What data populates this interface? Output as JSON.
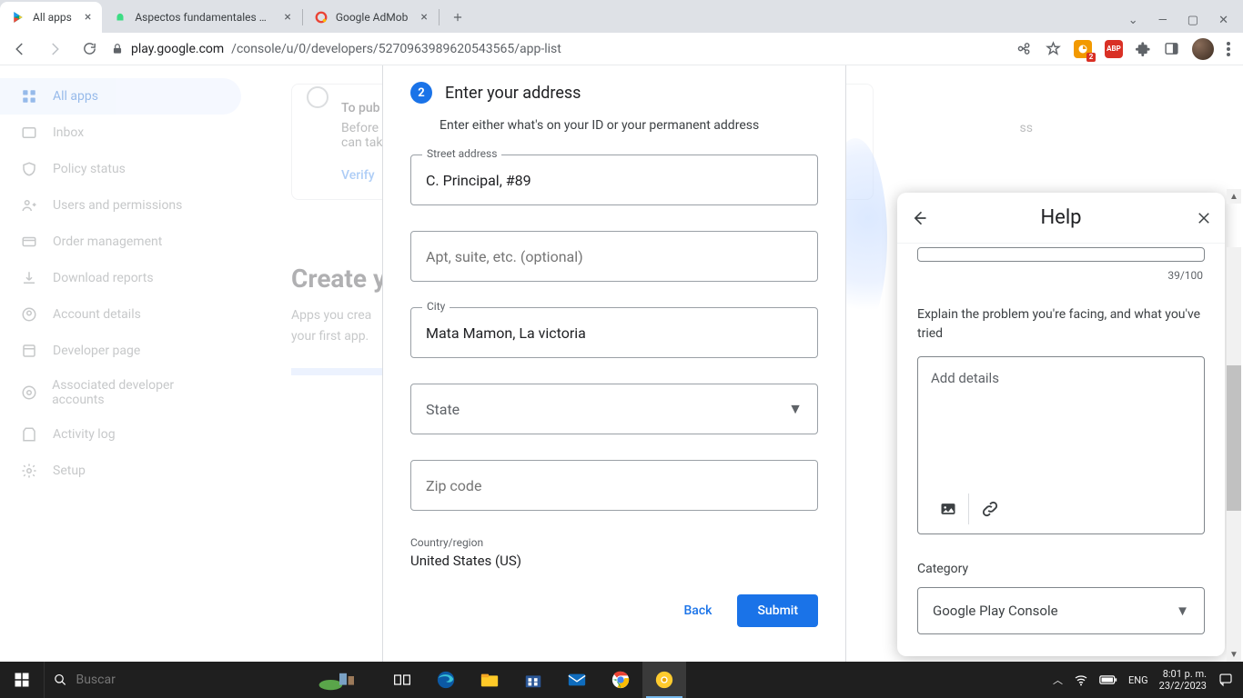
{
  "browser": {
    "tabs": [
      {
        "title": "All apps",
        "active": true
      },
      {
        "title": "Aspectos fundamentales de la ap",
        "active": false
      },
      {
        "title": "Google AdMob",
        "active": false
      }
    ],
    "url_host": "play.google.com",
    "url_path": "/console/u/0/developers/5270963989620543565/app-list",
    "ext_badge_count": "2",
    "ext_abp": "ABP"
  },
  "sidebar": {
    "items": [
      {
        "label": "All apps",
        "icon": "apps"
      },
      {
        "label": "Inbox",
        "icon": "inbox"
      },
      {
        "label": "Policy status",
        "icon": "shield"
      },
      {
        "label": "Users and permissions",
        "icon": "users"
      },
      {
        "label": "Order management",
        "icon": "card"
      },
      {
        "label": "Download reports",
        "icon": "download"
      },
      {
        "label": "Account details",
        "icon": "account"
      },
      {
        "label": "Developer page",
        "icon": "devpage"
      },
      {
        "label": "Associated developer accounts",
        "icon": "assoc"
      },
      {
        "label": "Activity log",
        "icon": "activity"
      },
      {
        "label": "Setup",
        "icon": "setup"
      }
    ]
  },
  "bg": {
    "line1": "To pub",
    "before": "Before",
    "cantake": "can take",
    "verify": "Verify",
    "heading": "Create yo",
    "para1": "Apps you crea",
    "para2": "your first app.",
    "right_cut": "ss"
  },
  "modal": {
    "step_number": "2",
    "step_title": "Enter your address",
    "step_desc": "Enter either what's on your ID or your permanent address",
    "street_label": "Street address",
    "street_value": "C. Principal, #89",
    "apt_placeholder": "Apt, suite, etc. (optional)",
    "city_label": "City",
    "city_value": "Mata Mamon, La victoria",
    "state_placeholder": "State",
    "zip_placeholder": "Zip code",
    "country_label": "Country/region",
    "country_value": "United States (US)",
    "back": "Back",
    "submit": "Submit"
  },
  "help": {
    "title": "Help",
    "char_count": "39/100",
    "explain": "Explain the problem you're facing, and what you've tried",
    "details_placeholder": "Add details",
    "category_label": "Category",
    "category_value": "Google Play Console"
  },
  "taskbar": {
    "search_placeholder": "Buscar",
    "lang": "ENG",
    "time": "8:01 p. m.",
    "date": "23/2/2023"
  }
}
